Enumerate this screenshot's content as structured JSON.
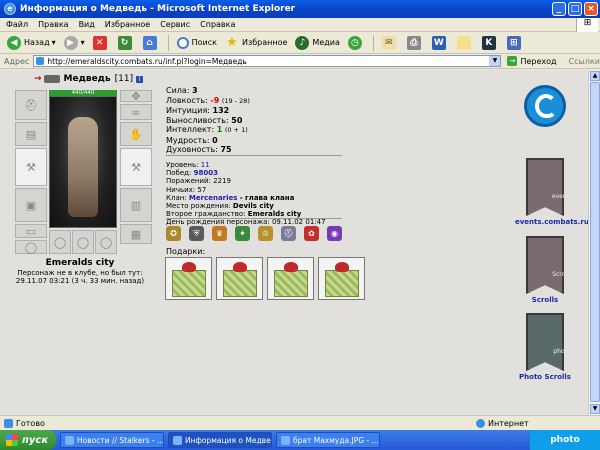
{
  "window": {
    "title": "Информация о Медведь - Microsoft Internet Explorer",
    "icon": "ie-icon",
    "buttons": [
      "minimize",
      "maximize",
      "close"
    ]
  },
  "menu": [
    "Файл",
    "Правка",
    "Вид",
    "Избранное",
    "Сервис",
    "Справка"
  ],
  "toolbar": {
    "back": "Назад",
    "search": "Поиск",
    "favorites": "Избранное",
    "media": "Медиа"
  },
  "address": {
    "label": "Адрес",
    "url": "http://emeraldscity.combats.ru/inf.pl?login=Медведь",
    "go": "Переход",
    "links": "Ссылки"
  },
  "character": {
    "name": "Медведь",
    "level": "[11]",
    "hp": "440/440",
    "city": "Emeralds city",
    "status_line1": "Персонаж не в клубе, но был тут:",
    "status_line2": "29.11.07 03:21 (3 ч. 33 мин. назад)"
  },
  "stats": {
    "strength_label": "Сила:",
    "strength": "3",
    "agility_label": "Ловкость:",
    "agility": "-9",
    "agility_extra": "(19 - 28)",
    "intuition_label": "Интуиция:",
    "intuition": "132",
    "endurance_label": "Выносливость:",
    "endurance": "50",
    "intellect_label": "Интеллект:",
    "intellect": "1",
    "intellect_extra": "(0 + 1)",
    "wisdom_label": "Мудрость:",
    "wisdom": "0",
    "spirituality_label": "Духовность:",
    "spirituality": "75"
  },
  "info": {
    "level_label": "Уровень:",
    "level": "11",
    "wins_label": "Побед:",
    "wins": "98003",
    "losses_label": "Поражений:",
    "losses": "2219",
    "draws_label": "Ничьих:",
    "draws": "57",
    "clan_label": "Клан:",
    "clan": "Mercenaries",
    "clan_role": "- глава клана",
    "birthplace_label": "Место рождения:",
    "birthplace": "Devils city",
    "citizenship_label": "Второе гражданство:",
    "citizenship": "Emeralds city",
    "birthday_label": "День рождения персонажа:",
    "birthday": "09.11.02 01:47"
  },
  "badges": [
    {
      "icon": "medal-icon",
      "color": "#a88a2a"
    },
    {
      "icon": "shield-icon",
      "color": "#5a5a5a"
    },
    {
      "icon": "crown-icon",
      "color": "#c07a20"
    },
    {
      "icon": "star-icon",
      "color": "#3a8a3a"
    },
    {
      "icon": "cup-icon",
      "color": "#b8902a"
    },
    {
      "icon": "helm-icon",
      "color": "#7a7a9a"
    },
    {
      "icon": "flower-icon",
      "color": "#c03030"
    },
    {
      "icon": "orb-icon",
      "color": "#7a3ab8"
    }
  ],
  "gifts": {
    "label": "Подарки:",
    "count": 4
  },
  "side": {
    "events_link": "events.combats.ru",
    "events_banner": "events",
    "scrolls_link": "Scrolls",
    "scrolls_banner": "Scrolls",
    "photo_link": "Photo Scrolls",
    "photo_banner": "photo"
  },
  "status": {
    "text": "Готово",
    "zone": "Интернет"
  },
  "taskbar": {
    "start": "пуск",
    "tasks": [
      "Новости // Stalkers - ...",
      "Информация о Медве...",
      "брат Махмуда.JPG - ..."
    ],
    "tray": "photo"
  }
}
